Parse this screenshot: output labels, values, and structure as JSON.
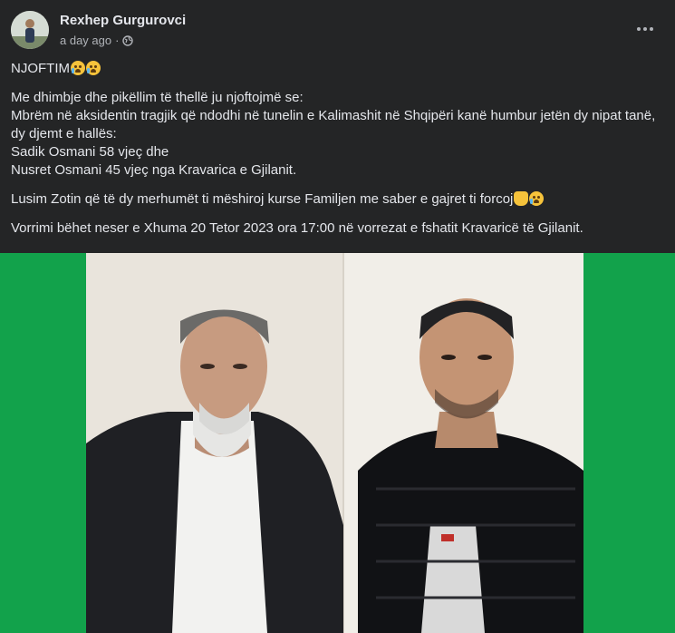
{
  "post": {
    "author": "Rexhep Gurgurovci",
    "time": "a day ago",
    "separator": "·",
    "privacy_icon": "globe-icon",
    "more_icon": "more-options-icon",
    "paragraphs": {
      "p1": "NJOFTIM",
      "p2": "Me dhimbje dhe pikëllim të thellë ju njoftojmë se:\nMbrëm në aksidentin tragjik që ndodhi në tunelin e Kalimashit në Shqipëri kanë humbur jetën dy nipat tanë, dy djemt e hallës:\nSadik Osmani 58 vjeç dhe\nNusret Osmani 45 vjeç nga Kravarica e Gjilanit.",
      "p3": "Lusim Zotin që të dy merhumët ti mëshiroj kurse Familjen me saber e gajret ti forcoj",
      "p4": "Vorrimi bëhet neser e Xhuma 20 Tetor 2023 ora 17:00 në vorrezat e fshatit Kravaricë të Gjilanit."
    },
    "emojis": [
      "crying-face-emoji",
      "crying-face-emoji",
      "open-hands-emoji",
      "crying-face-emoji"
    ],
    "image_background": "#12a24b"
  },
  "colors": {
    "background": "#242526",
    "primary_text": "#e4e6eb",
    "secondary_text": "#b0b3b8",
    "image_border": "#12a24b"
  }
}
